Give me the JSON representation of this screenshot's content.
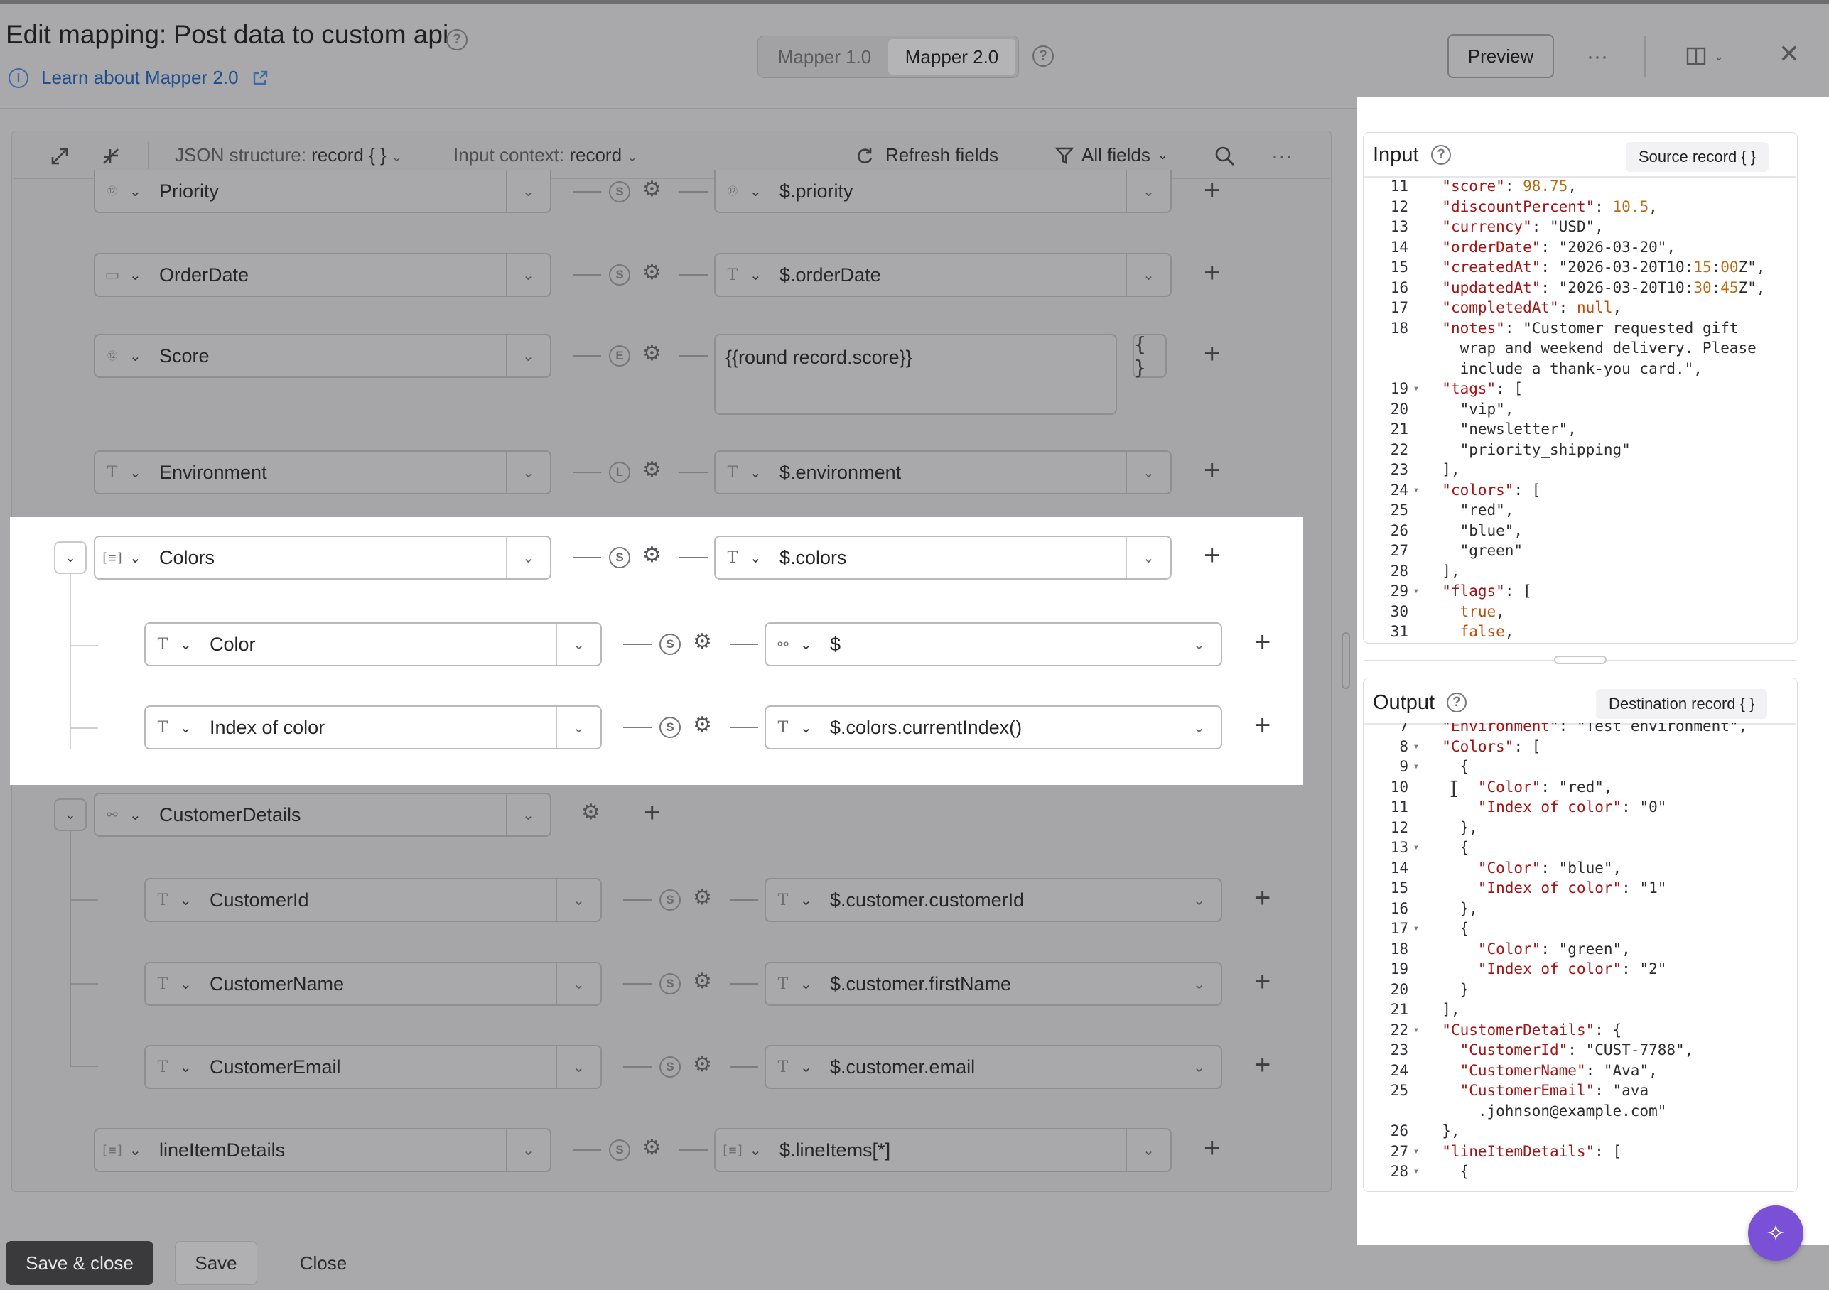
{
  "header": {
    "title": "Edit mapping: Post data to custom api",
    "learn_link": "Learn about Mapper 2.0",
    "mapper_v1": "Mapper 1.0",
    "mapper_v2": "Mapper 2.0",
    "preview": "Preview"
  },
  "toolbar": {
    "json_structure_label": "JSON structure:",
    "json_structure_value": "record { }",
    "input_context_label": "Input context:",
    "input_context_value": "record",
    "refresh": "Refresh fields",
    "filter": "All fields"
  },
  "rows": {
    "priority": {
      "dest": "Priority",
      "src": "$.priority"
    },
    "orderdate": {
      "dest": "OrderDate",
      "src": "$.orderDate"
    },
    "score": {
      "dest": "Score",
      "src": "{{round record.score}}",
      "braces": "{ }"
    },
    "environment": {
      "dest": "Environment",
      "src": "$.environment"
    },
    "colors": {
      "dest": "Colors",
      "src": "$.colors"
    },
    "color": {
      "dest": "Color",
      "src": "$"
    },
    "index": {
      "dest": "Index of color",
      "src": "$.colors.currentIndex()"
    },
    "customerdetails": {
      "dest": "CustomerDetails"
    },
    "customerid": {
      "dest": "CustomerId",
      "src": "$.customer.customerId"
    },
    "customername": {
      "dest": "CustomerName",
      "src": "$.customer.firstName"
    },
    "customeremail": {
      "dest": "CustomerEmail",
      "src": "$.customer.email"
    },
    "lineitems": {
      "dest": "lineItemDetails",
      "src": "$.lineItems[*]"
    }
  },
  "input_panel": {
    "title": "Input",
    "pill": "Source record { }",
    "lines": [
      {
        "n": "11",
        "t": "  \"score\": 98.75,"
      },
      {
        "n": "12",
        "t": "  \"discountPercent\": 10.5,"
      },
      {
        "n": "13",
        "t": "  \"currency\": \"USD\","
      },
      {
        "n": "14",
        "t": "  \"orderDate\": \"2026-03-20\","
      },
      {
        "n": "15",
        "t": "  \"createdAt\": \"2026-03-20T10:15:00Z\","
      },
      {
        "n": "16",
        "t": "  \"updatedAt\": \"2026-03-20T10:30:45Z\","
      },
      {
        "n": "17",
        "t": "  \"completedAt\": null,"
      },
      {
        "n": "18",
        "t": "  \"notes\": \"Customer requested gift"
      },
      {
        "n": "",
        "t": "    wrap and weekend delivery. Please"
      },
      {
        "n": "",
        "t": "    include a thank-you card.\","
      },
      {
        "n": "19",
        "t": "  \"tags\": [",
        "f": "▾"
      },
      {
        "n": "20",
        "t": "    \"vip\","
      },
      {
        "n": "21",
        "t": "    \"newsletter\","
      },
      {
        "n": "22",
        "t": "    \"priority_shipping\""
      },
      {
        "n": "23",
        "t": "  ],"
      },
      {
        "n": "24",
        "t": "  \"colors\": [",
        "f": "▾"
      },
      {
        "n": "25",
        "t": "    \"red\","
      },
      {
        "n": "26",
        "t": "    \"blue\","
      },
      {
        "n": "27",
        "t": "    \"green\""
      },
      {
        "n": "28",
        "t": "  ],"
      },
      {
        "n": "29",
        "t": "  \"flags\": [",
        "f": "▾"
      },
      {
        "n": "30",
        "t": "    true,"
      },
      {
        "n": "31",
        "t": "    false,"
      }
    ]
  },
  "output_panel": {
    "title": "Output",
    "pill": "Destination record { }",
    "lines": [
      {
        "n": "7",
        "t": "  \"Environment\": \"Test environment\","
      },
      {
        "n": "8",
        "t": "  \"Colors\": [",
        "f": "▾"
      },
      {
        "n": "9",
        "t": "    {",
        "f": "▾"
      },
      {
        "n": "10",
        "t": "      \"Color\": \"red\","
      },
      {
        "n": "11",
        "t": "      \"Index of color\": \"0\""
      },
      {
        "n": "12",
        "t": "    },"
      },
      {
        "n": "13",
        "t": "    {",
        "f": "▾"
      },
      {
        "n": "14",
        "t": "      \"Color\": \"blue\","
      },
      {
        "n": "15",
        "t": "      \"Index of color\": \"1\""
      },
      {
        "n": "16",
        "t": "    },"
      },
      {
        "n": "17",
        "t": "    {",
        "f": "▾"
      },
      {
        "n": "18",
        "t": "      \"Color\": \"green\","
      },
      {
        "n": "19",
        "t": "      \"Index of color\": \"2\""
      },
      {
        "n": "20",
        "t": "    }"
      },
      {
        "n": "21",
        "t": "  ],"
      },
      {
        "n": "22",
        "t": "  \"CustomerDetails\": {",
        "f": "▾"
      },
      {
        "n": "23",
        "t": "    \"CustomerId\": \"CUST-7788\","
      },
      {
        "n": "24",
        "t": "    \"CustomerName\": \"Ava\","
      },
      {
        "n": "25",
        "t": "    \"CustomerEmail\": \"ava"
      },
      {
        "n": "",
        "t": "      .johnson@example.com\""
      },
      {
        "n": "26",
        "t": "  },"
      },
      {
        "n": "27",
        "t": "  \"lineItemDetails\": [",
        "f": "▾"
      },
      {
        "n": "28",
        "t": "    {",
        "f": "▾"
      }
    ]
  },
  "footer": {
    "save_close": "Save & close",
    "save": "Save",
    "close": "Close"
  },
  "colors": {
    "accent": "#7a51d6",
    "link": "#1f4f8f",
    "json_key": "#a31515",
    "json_number": "#b86b14",
    "json_bool": "#c04d09"
  }
}
